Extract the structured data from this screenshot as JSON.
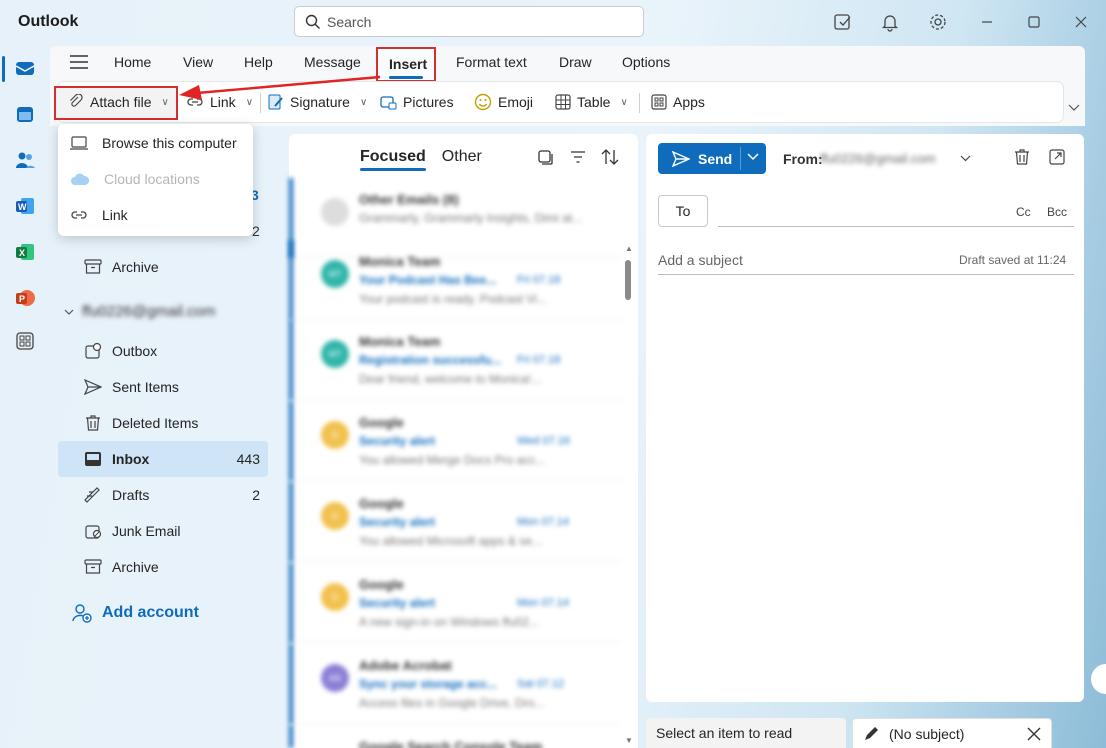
{
  "app": {
    "title": "Outlook"
  },
  "search": {
    "placeholder": "Search"
  },
  "ribbon": {
    "tabs": [
      "Home",
      "View",
      "Help",
      "Message",
      "Insert",
      "Format text",
      "Draw",
      "Options"
    ],
    "active_tab": "Insert",
    "tools": {
      "attach": "Attach file",
      "link": "Link",
      "signature": "Signature",
      "pictures": "Pictures",
      "emoji": "Emoji",
      "table": "Table",
      "apps": "Apps"
    }
  },
  "attach_menu": {
    "items": [
      "Browse this computer",
      "Cloud locations",
      "Link"
    ],
    "disabled": [
      "Cloud locations"
    ]
  },
  "folders": {
    "partial_counts": [
      "3",
      "2"
    ],
    "archive_top": "Archive",
    "account": "ffu0226@gmail.com",
    "items": [
      {
        "label": "Outbox",
        "count": ""
      },
      {
        "label": "Sent Items",
        "count": ""
      },
      {
        "label": "Deleted Items",
        "count": ""
      },
      {
        "label": "Inbox",
        "count": "443"
      },
      {
        "label": "Drafts",
        "count": "2"
      },
      {
        "label": "Junk Email",
        "count": ""
      },
      {
        "label": "Archive",
        "count": ""
      }
    ],
    "add_account": "Add account"
  },
  "message_list": {
    "tabs": [
      "Focused",
      "Other"
    ],
    "active_tab": "Focused",
    "messages": [
      {
        "avatar": "",
        "sender": "Other Emails (8)",
        "subject": "",
        "date": "",
        "preview": "Grammarly, Grammarly Insights, Dimi at..."
      },
      {
        "avatar": "MT",
        "sender": "Monica Team",
        "subject": "Your Podcast Has Bee...",
        "date": "Fri 07.18",
        "preview": "Your podcast is ready. Podcast Vi..."
      },
      {
        "avatar": "MT",
        "sender": "Monica Team",
        "subject": "Registration successfu...",
        "date": "Fri 07.18",
        "preview": "Dear friend, welcome to Monica!..."
      },
      {
        "avatar": "G",
        "sender": "Google",
        "subject": "Security alert",
        "date": "Wed 07.16",
        "preview": "You allowed Merge Docs Pro acc..."
      },
      {
        "avatar": "G",
        "sender": "Google",
        "subject": "Security alert",
        "date": "Mon 07.14",
        "preview": "You allowed Microsoft apps & se..."
      },
      {
        "avatar": "G",
        "sender": "Google",
        "subject": "Security alert",
        "date": "Mon 07.14",
        "preview": "A new sign-in on Windows ffu02..."
      },
      {
        "avatar": "AA",
        "sender": "Adobe Acrobat",
        "subject": "Sync your storage acc...",
        "date": "Sat 07.12",
        "preview": "Access files in Google Drive, Dro..."
      },
      {
        "avatar": "",
        "sender": "Google Search Console Team",
        "subject": "",
        "date": "",
        "preview": ""
      }
    ]
  },
  "compose": {
    "send": "Send",
    "from_label": "From:",
    "from_address": "ffu0226@gmail.com",
    "to": "To",
    "cc": "Cc",
    "bcc": "Bcc",
    "subject_placeholder": "Add a subject",
    "draft_status": "Draft saved at 11:24"
  },
  "bottom_tabs": {
    "reading": "Select an item to read",
    "draft": "(No subject)"
  },
  "colors": {
    "accent": "#0f6cbd",
    "highlight": "#d32f2f",
    "selected_folder": "#cfe4f6"
  }
}
